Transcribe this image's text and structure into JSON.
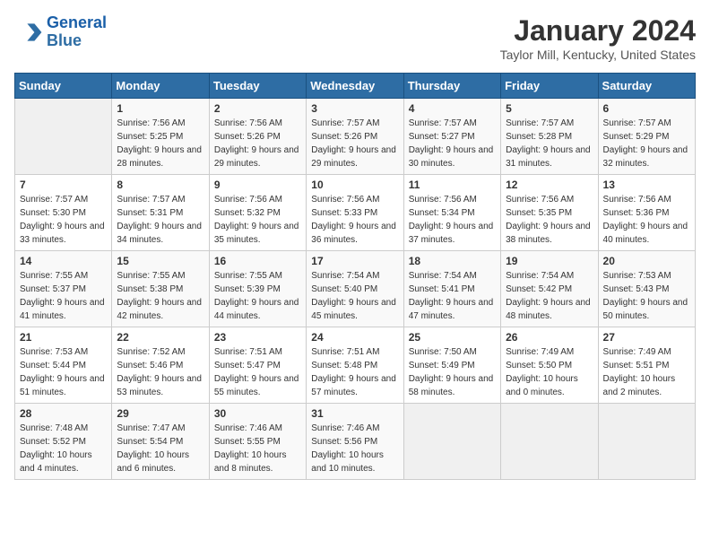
{
  "header": {
    "logo_line1": "General",
    "logo_line2": "Blue",
    "month": "January 2024",
    "location": "Taylor Mill, Kentucky, United States"
  },
  "days_of_week": [
    "Sunday",
    "Monday",
    "Tuesday",
    "Wednesday",
    "Thursday",
    "Friday",
    "Saturday"
  ],
  "weeks": [
    [
      {
        "day": "",
        "empty": true
      },
      {
        "day": "1",
        "sunrise": "Sunrise: 7:56 AM",
        "sunset": "Sunset: 5:25 PM",
        "daylight": "Daylight: 9 hours and 28 minutes."
      },
      {
        "day": "2",
        "sunrise": "Sunrise: 7:56 AM",
        "sunset": "Sunset: 5:26 PM",
        "daylight": "Daylight: 9 hours and 29 minutes."
      },
      {
        "day": "3",
        "sunrise": "Sunrise: 7:57 AM",
        "sunset": "Sunset: 5:26 PM",
        "daylight": "Daylight: 9 hours and 29 minutes."
      },
      {
        "day": "4",
        "sunrise": "Sunrise: 7:57 AM",
        "sunset": "Sunset: 5:27 PM",
        "daylight": "Daylight: 9 hours and 30 minutes."
      },
      {
        "day": "5",
        "sunrise": "Sunrise: 7:57 AM",
        "sunset": "Sunset: 5:28 PM",
        "daylight": "Daylight: 9 hours and 31 minutes."
      },
      {
        "day": "6",
        "sunrise": "Sunrise: 7:57 AM",
        "sunset": "Sunset: 5:29 PM",
        "daylight": "Daylight: 9 hours and 32 minutes."
      }
    ],
    [
      {
        "day": "7",
        "sunrise": "Sunrise: 7:57 AM",
        "sunset": "Sunset: 5:30 PM",
        "daylight": "Daylight: 9 hours and 33 minutes."
      },
      {
        "day": "8",
        "sunrise": "Sunrise: 7:57 AM",
        "sunset": "Sunset: 5:31 PM",
        "daylight": "Daylight: 9 hours and 34 minutes."
      },
      {
        "day": "9",
        "sunrise": "Sunrise: 7:56 AM",
        "sunset": "Sunset: 5:32 PM",
        "daylight": "Daylight: 9 hours and 35 minutes."
      },
      {
        "day": "10",
        "sunrise": "Sunrise: 7:56 AM",
        "sunset": "Sunset: 5:33 PM",
        "daylight": "Daylight: 9 hours and 36 minutes."
      },
      {
        "day": "11",
        "sunrise": "Sunrise: 7:56 AM",
        "sunset": "Sunset: 5:34 PM",
        "daylight": "Daylight: 9 hours and 37 minutes."
      },
      {
        "day": "12",
        "sunrise": "Sunrise: 7:56 AM",
        "sunset": "Sunset: 5:35 PM",
        "daylight": "Daylight: 9 hours and 38 minutes."
      },
      {
        "day": "13",
        "sunrise": "Sunrise: 7:56 AM",
        "sunset": "Sunset: 5:36 PM",
        "daylight": "Daylight: 9 hours and 40 minutes."
      }
    ],
    [
      {
        "day": "14",
        "sunrise": "Sunrise: 7:55 AM",
        "sunset": "Sunset: 5:37 PM",
        "daylight": "Daylight: 9 hours and 41 minutes."
      },
      {
        "day": "15",
        "sunrise": "Sunrise: 7:55 AM",
        "sunset": "Sunset: 5:38 PM",
        "daylight": "Daylight: 9 hours and 42 minutes."
      },
      {
        "day": "16",
        "sunrise": "Sunrise: 7:55 AM",
        "sunset": "Sunset: 5:39 PM",
        "daylight": "Daylight: 9 hours and 44 minutes."
      },
      {
        "day": "17",
        "sunrise": "Sunrise: 7:54 AM",
        "sunset": "Sunset: 5:40 PM",
        "daylight": "Daylight: 9 hours and 45 minutes."
      },
      {
        "day": "18",
        "sunrise": "Sunrise: 7:54 AM",
        "sunset": "Sunset: 5:41 PM",
        "daylight": "Daylight: 9 hours and 47 minutes."
      },
      {
        "day": "19",
        "sunrise": "Sunrise: 7:54 AM",
        "sunset": "Sunset: 5:42 PM",
        "daylight": "Daylight: 9 hours and 48 minutes."
      },
      {
        "day": "20",
        "sunrise": "Sunrise: 7:53 AM",
        "sunset": "Sunset: 5:43 PM",
        "daylight": "Daylight: 9 hours and 50 minutes."
      }
    ],
    [
      {
        "day": "21",
        "sunrise": "Sunrise: 7:53 AM",
        "sunset": "Sunset: 5:44 PM",
        "daylight": "Daylight: 9 hours and 51 minutes."
      },
      {
        "day": "22",
        "sunrise": "Sunrise: 7:52 AM",
        "sunset": "Sunset: 5:46 PM",
        "daylight": "Daylight: 9 hours and 53 minutes."
      },
      {
        "day": "23",
        "sunrise": "Sunrise: 7:51 AM",
        "sunset": "Sunset: 5:47 PM",
        "daylight": "Daylight: 9 hours and 55 minutes."
      },
      {
        "day": "24",
        "sunrise": "Sunrise: 7:51 AM",
        "sunset": "Sunset: 5:48 PM",
        "daylight": "Daylight: 9 hours and 57 minutes."
      },
      {
        "day": "25",
        "sunrise": "Sunrise: 7:50 AM",
        "sunset": "Sunset: 5:49 PM",
        "daylight": "Daylight: 9 hours and 58 minutes."
      },
      {
        "day": "26",
        "sunrise": "Sunrise: 7:49 AM",
        "sunset": "Sunset: 5:50 PM",
        "daylight": "Daylight: 10 hours and 0 minutes."
      },
      {
        "day": "27",
        "sunrise": "Sunrise: 7:49 AM",
        "sunset": "Sunset: 5:51 PM",
        "daylight": "Daylight: 10 hours and 2 minutes."
      }
    ],
    [
      {
        "day": "28",
        "sunrise": "Sunrise: 7:48 AM",
        "sunset": "Sunset: 5:52 PM",
        "daylight": "Daylight: 10 hours and 4 minutes."
      },
      {
        "day": "29",
        "sunrise": "Sunrise: 7:47 AM",
        "sunset": "Sunset: 5:54 PM",
        "daylight": "Daylight: 10 hours and 6 minutes."
      },
      {
        "day": "30",
        "sunrise": "Sunrise: 7:46 AM",
        "sunset": "Sunset: 5:55 PM",
        "daylight": "Daylight: 10 hours and 8 minutes."
      },
      {
        "day": "31",
        "sunrise": "Sunrise: 7:46 AM",
        "sunset": "Sunset: 5:56 PM",
        "daylight": "Daylight: 10 hours and 10 minutes."
      },
      {
        "day": "",
        "empty": true
      },
      {
        "day": "",
        "empty": true
      },
      {
        "day": "",
        "empty": true
      }
    ]
  ]
}
